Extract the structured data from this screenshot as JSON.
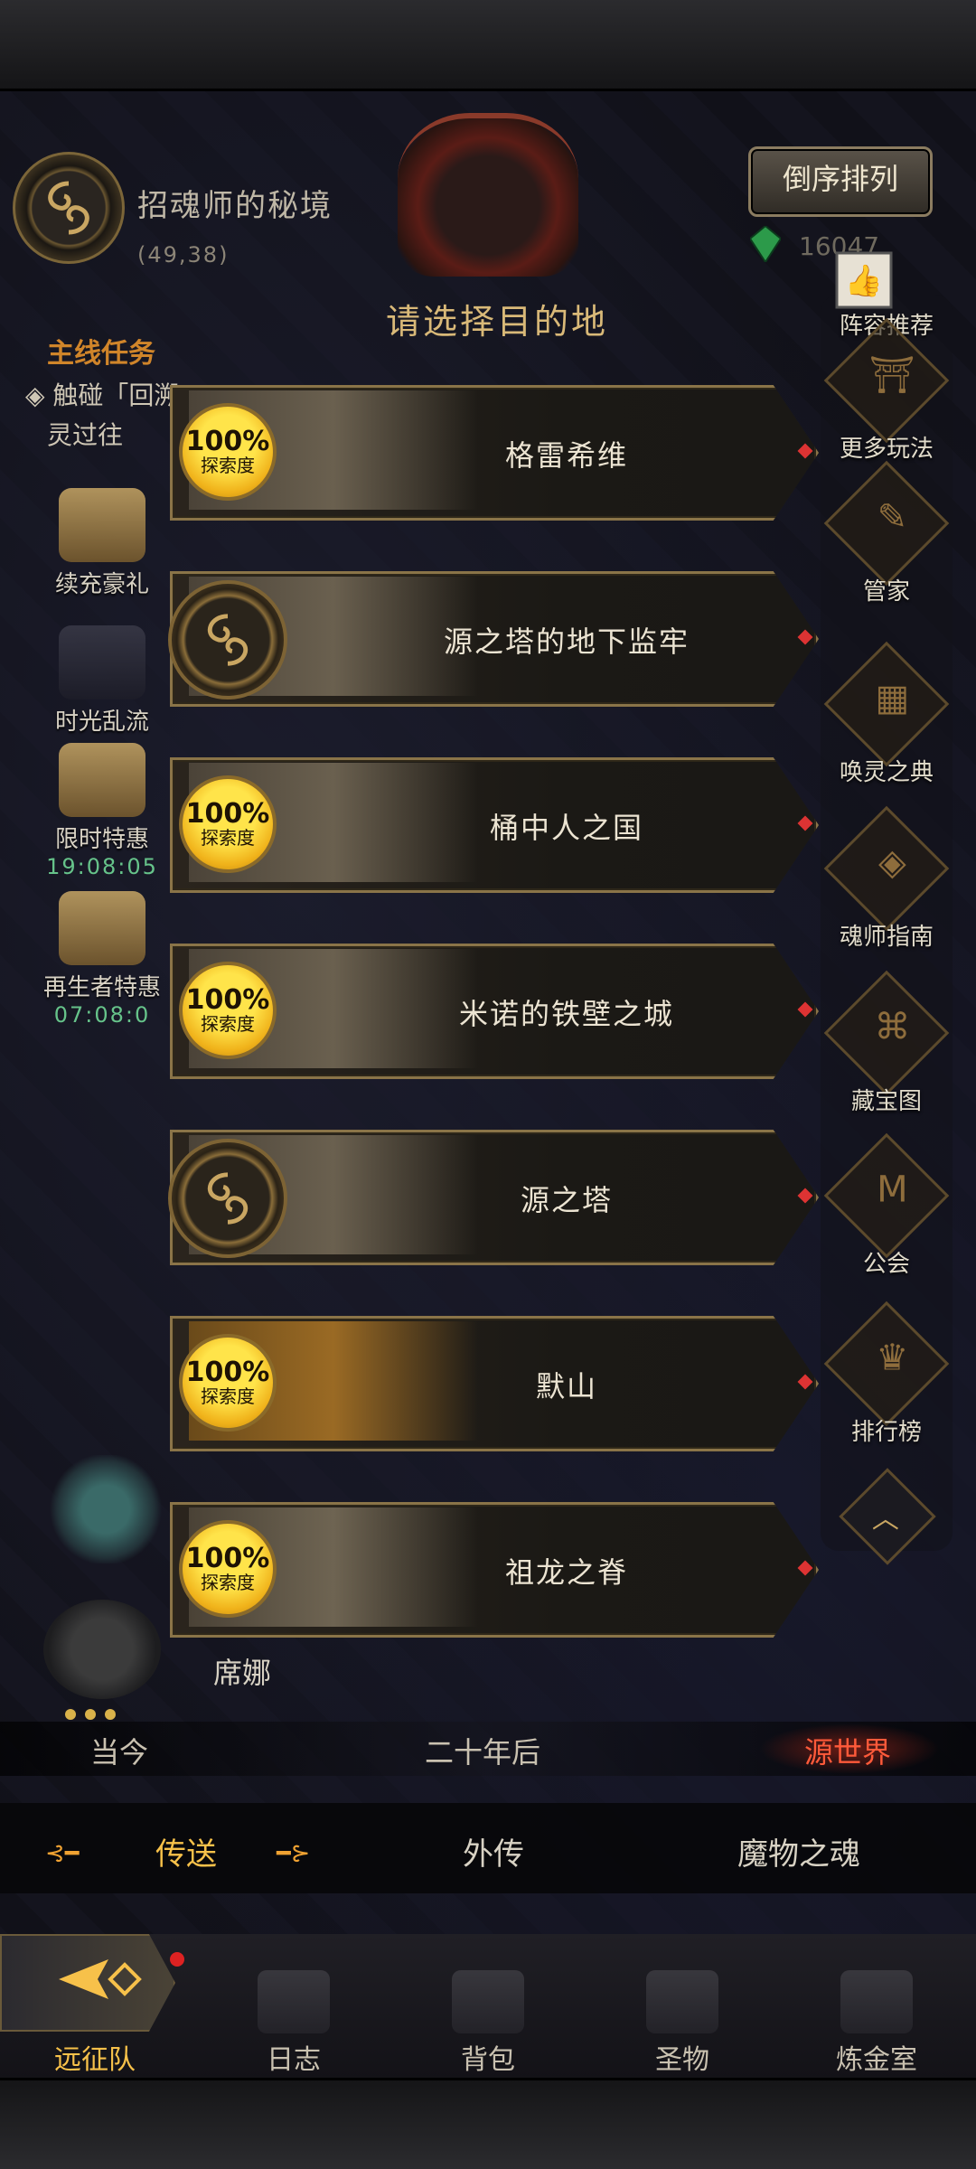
{
  "location": {
    "name": "招魂师的秘境",
    "coords": "(49,38)"
  },
  "header": {
    "sort_label": "倒序排列",
    "gem_count": "16047",
    "title": "请选择目的地"
  },
  "quest": {
    "title": "主线任务",
    "line1": "◈ 触碰「回溯」",
    "line2": "灵过往"
  },
  "left_items": [
    {
      "label": "续充豪礼"
    },
    {
      "label": "时光乱流"
    },
    {
      "label": "限时特惠",
      "timer": "19:08:05"
    },
    {
      "label": "再生者特惠",
      "timer": "07:08:0"
    }
  ],
  "right_items": [
    {
      "label": "阵容推荐",
      "glyph": "👍"
    },
    {
      "label": "更多玩法",
      "glyph": "⛩"
    },
    {
      "label": "管家",
      "glyph": "✎"
    },
    {
      "label": "唤灵之典",
      "glyph": "▦"
    },
    {
      "label": "魂师指南",
      "glyph": "◈"
    },
    {
      "label": "藏宝图",
      "glyph": "⌘"
    },
    {
      "label": "公会",
      "glyph": "M"
    },
    {
      "label": "排行榜",
      "glyph": "♛"
    }
  ],
  "destinations": [
    {
      "name": "格雷希维",
      "progress": "100%",
      "progress_label": "探索度"
    },
    {
      "name": "源之塔的地下监牢"
    },
    {
      "name": "桶中人之国",
      "progress": "100%",
      "progress_label": "探索度"
    },
    {
      "name": "米诺的铁壁之城",
      "progress": "100%",
      "progress_label": "探索度"
    },
    {
      "name": "源之塔"
    },
    {
      "name": "默山",
      "progress": "100%",
      "progress_label": "探索度"
    },
    {
      "name": "祖龙之脊",
      "progress": "100%",
      "progress_label": "探索度"
    }
  ],
  "companion": {
    "name": "席娜"
  },
  "eras": [
    {
      "label": "当今"
    },
    {
      "label": "二十年后"
    },
    {
      "label": "源世界",
      "active": true
    }
  ],
  "function_tabs": [
    {
      "label": "传送",
      "active": true
    },
    {
      "label": "外传"
    },
    {
      "label": "魔物之魂"
    }
  ],
  "nav": [
    {
      "label": "远征队",
      "active": true
    },
    {
      "label": "日志"
    },
    {
      "label": "背包"
    },
    {
      "label": "圣物"
    },
    {
      "label": "炼金室"
    }
  ],
  "colors": {
    "accent_gold": "#f7c14a",
    "active_era": "#ff5a3a",
    "card_border": "#8a7448",
    "timer_green": "#66c38a"
  }
}
